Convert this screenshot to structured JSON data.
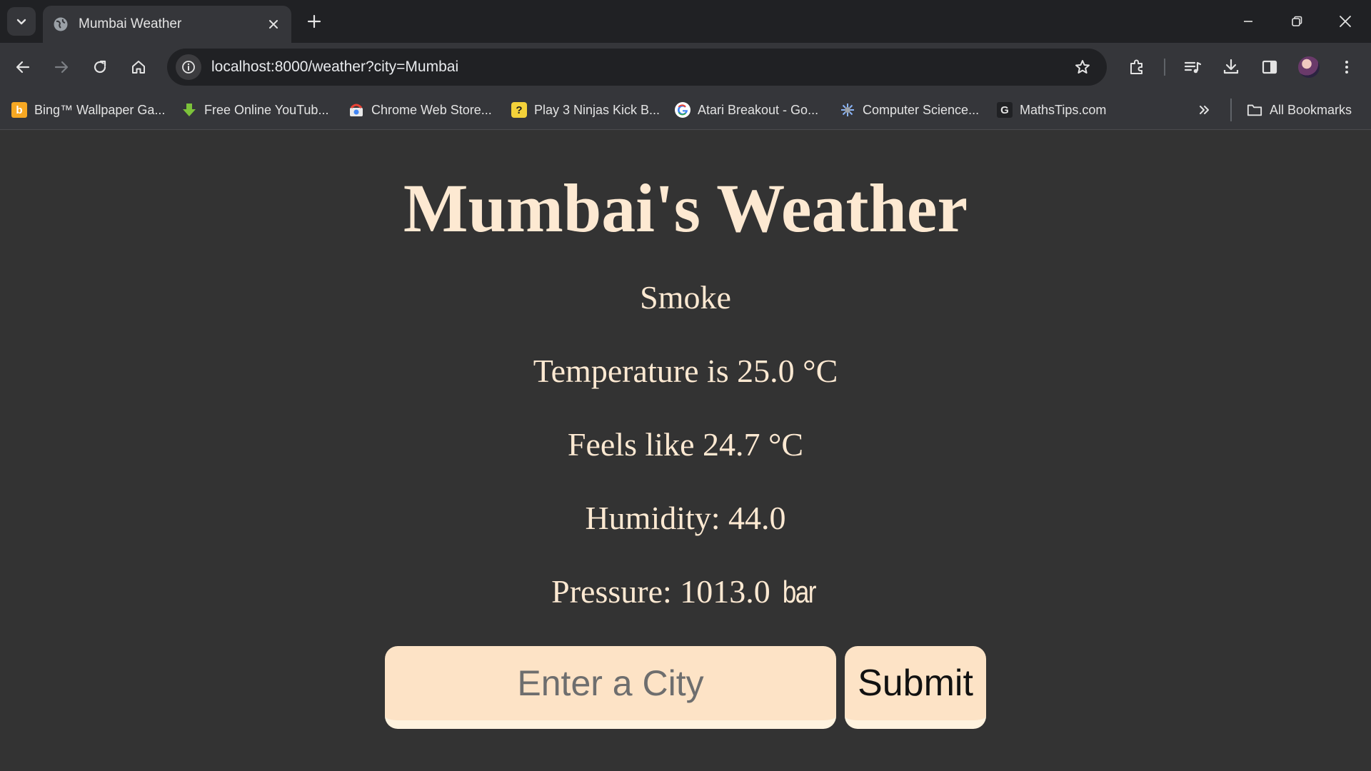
{
  "browser": {
    "tab": {
      "title": "Mumbai Weather"
    },
    "address_bar": {
      "url": "localhost:8000/weather?city=Mumbai"
    },
    "bookmarks": [
      {
        "label": "Bing™ Wallpaper Ga...",
        "icon": "bing-icon"
      },
      {
        "label": "Free Online YouTub...",
        "icon": "download-arrow-icon"
      },
      {
        "label": "Chrome Web Store...",
        "icon": "chrome-web-store-icon"
      },
      {
        "label": "Play 3 Ninjas Kick B...",
        "icon": "ninja-icon"
      },
      {
        "label": "Atari Breakout - Go...",
        "icon": "google-icon"
      },
      {
        "label": "Computer Science...",
        "icon": "computer-science-icon"
      },
      {
        "label": "MathsTips.com",
        "icon": "mathstips-icon"
      }
    ],
    "all_bookmarks_label": "All Bookmarks",
    "colors": {
      "tabstrip": "#202124",
      "toolbar": "#35363a",
      "page_bg": "#333333"
    }
  },
  "weather": {
    "heading": "Mumbai's Weather",
    "condition": "Smoke",
    "temperature": "Temperature is 25.0 °C",
    "feels_like": "Feels like 24.7 °C",
    "humidity": "Humidity: 44.0",
    "pressure_value": "Pressure: 1013.0",
    "pressure_unit": "bar",
    "colors": {
      "text": "#fde9d2",
      "input_bg": "#fde3c6"
    }
  },
  "form": {
    "city_placeholder": "Enter a City",
    "city_value": "",
    "submit_label": "Submit"
  }
}
